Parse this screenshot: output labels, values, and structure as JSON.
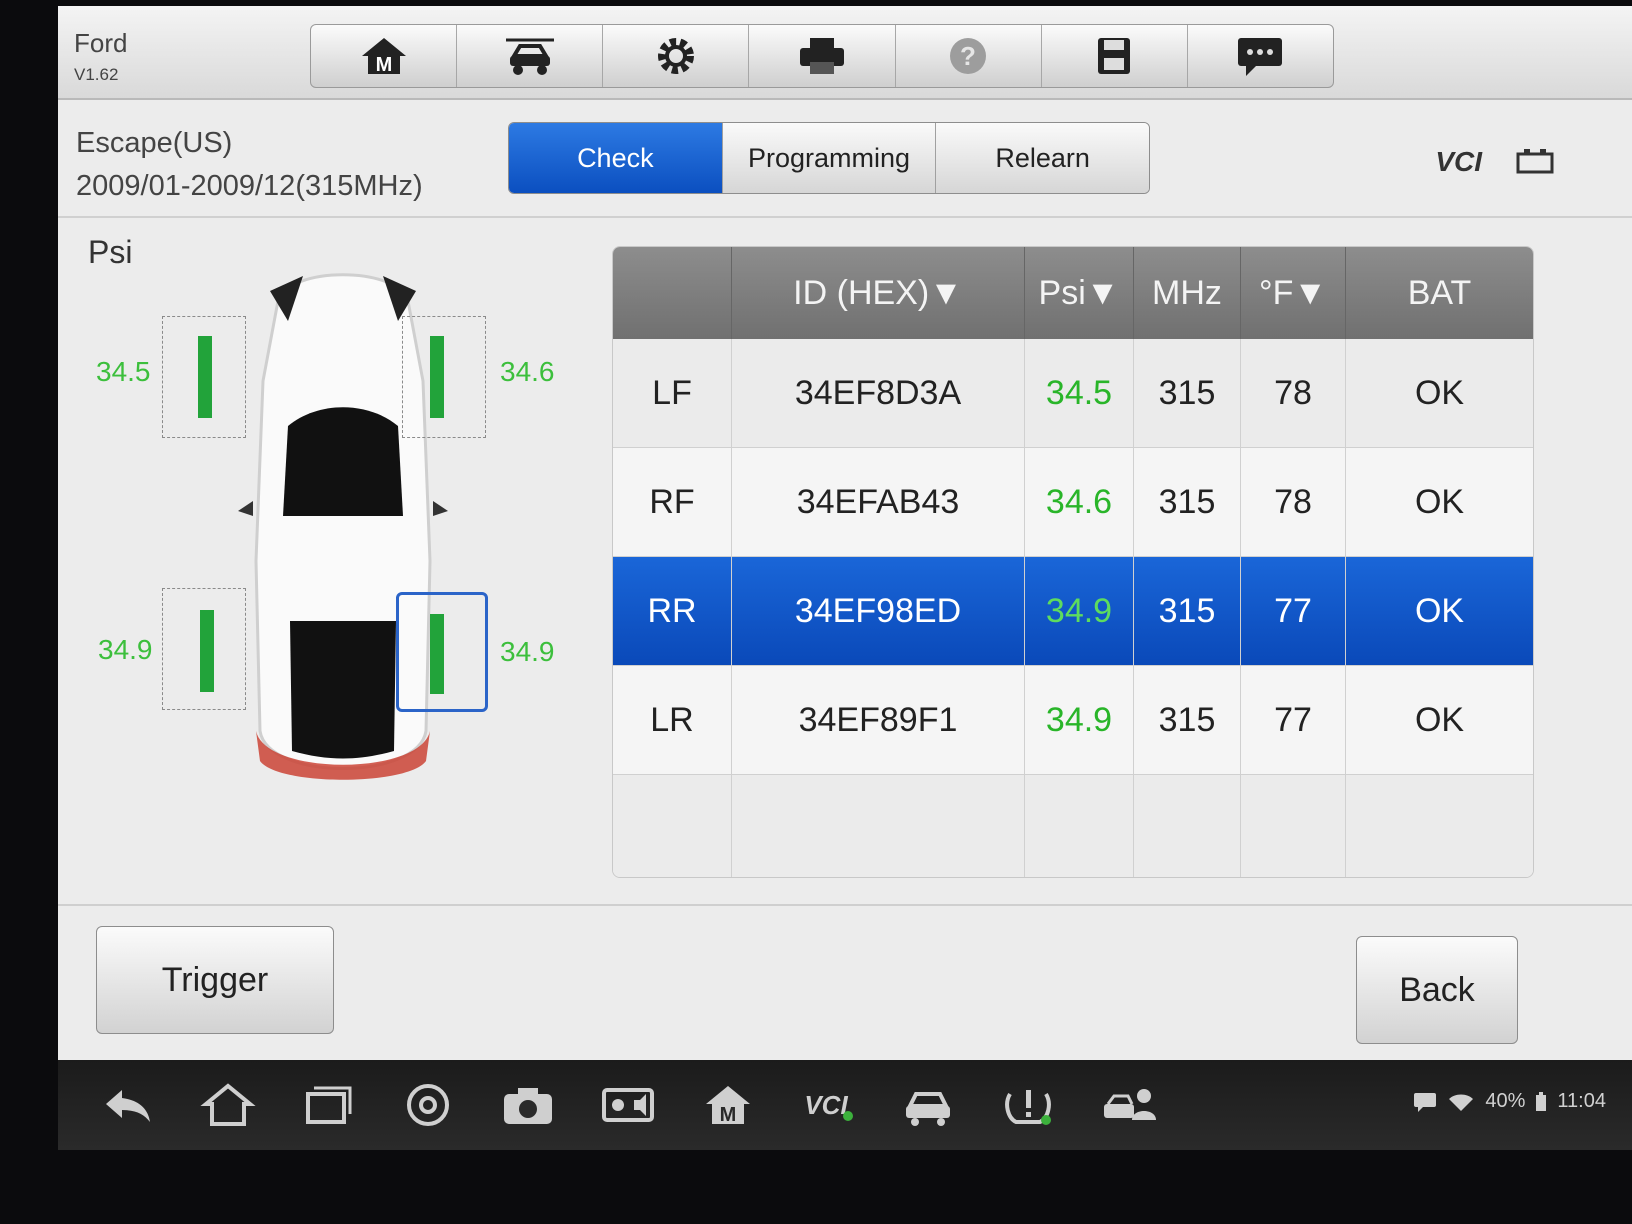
{
  "brand": {
    "make": "Ford",
    "version": "V1.62"
  },
  "toolbar": {
    "icons": [
      "home-m-icon",
      "car-lift-icon",
      "gear-icon",
      "printer-icon",
      "help-icon",
      "save-icon",
      "message-icon"
    ]
  },
  "vehicle": {
    "model": "Escape(US)",
    "range": "2009/01-2009/12(315MHz)"
  },
  "tabs": [
    {
      "label": "Check",
      "active": true
    },
    {
      "label": "Programming",
      "active": false
    },
    {
      "label": "Relearn",
      "active": false
    }
  ],
  "vci": {
    "label": "VCI"
  },
  "unit_label": "Psi",
  "tire_values": {
    "LF": "34.5",
    "RF": "34.6",
    "LR": "34.9",
    "RR": "34.9"
  },
  "table": {
    "headers": [
      "",
      "ID (HEX)▼",
      "Psi▼",
      "MHz",
      "°F▼",
      "BAT"
    ],
    "rows": [
      {
        "pos": "LF",
        "id": "34EF8D3A",
        "psi": "34.5",
        "mhz": "315",
        "temp": "78",
        "bat": "OK",
        "selected": false
      },
      {
        "pos": "RF",
        "id": "34EFAB43",
        "psi": "34.6",
        "mhz": "315",
        "temp": "78",
        "bat": "OK",
        "selected": false
      },
      {
        "pos": "RR",
        "id": "34EF98ED",
        "psi": "34.9",
        "mhz": "315",
        "temp": "77",
        "bat": "OK",
        "selected": true
      },
      {
        "pos": "LR",
        "id": "34EF89F1",
        "psi": "34.9",
        "mhz": "315",
        "temp": "77",
        "bat": "OK",
        "selected": false
      }
    ]
  },
  "buttons": {
    "trigger": "Trigger",
    "back": "Back"
  },
  "status_bar": {
    "battery": "40%",
    "time": "11:04"
  },
  "colors": {
    "accent": "#0b4fc0",
    "pressure_green": "#29b529"
  }
}
